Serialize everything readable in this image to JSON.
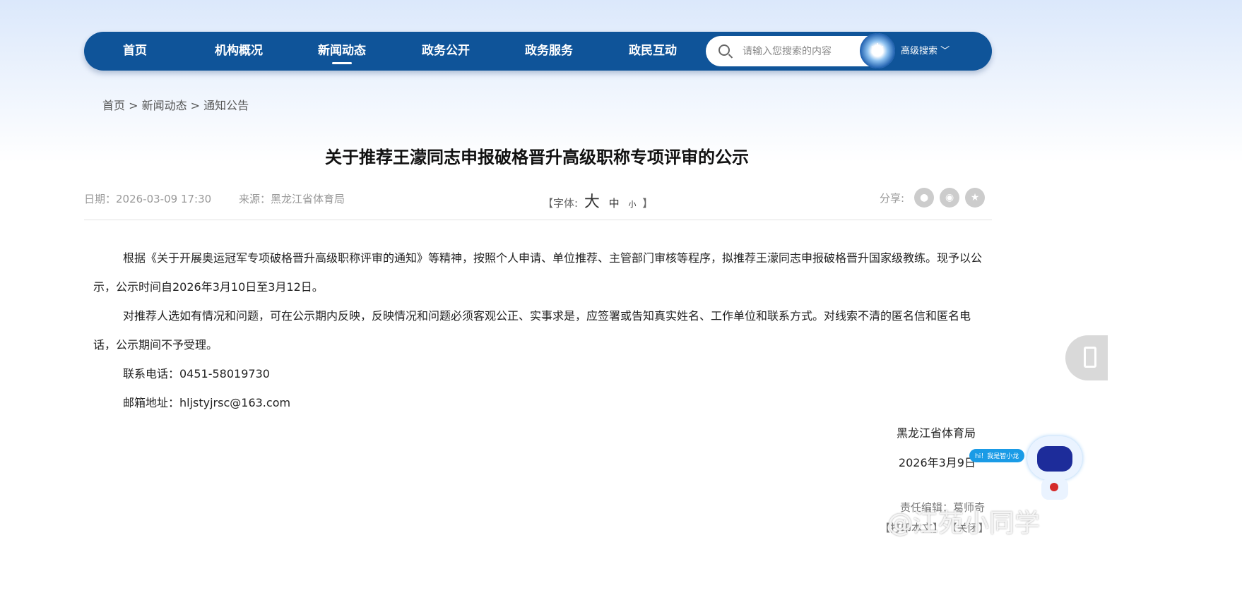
{
  "nav": {
    "items": [
      "首页",
      "机构概况",
      "新闻动态",
      "政务公开",
      "政务服务",
      "政民互动"
    ],
    "active": 2,
    "search_placeholder": "请输入您搜索的内容",
    "advanced": "高级搜索"
  },
  "breadcrumb": "首页 > 新闻动态 > 通知公告",
  "article": {
    "title": "关于推荐王濛同志申报破格晋升高级职称专项评审的公示",
    "date": "日期：2026-03-09 17:30",
    "source": "来源：黑龙江省体育局",
    "font_label_open": "【字体:",
    "font_large": "大",
    "font_medium": "中",
    "font_small": "小",
    "font_label_close": "】",
    "share_label": "分享:",
    "paragraphs": [
      "根据《关于开展奥运冠军专项破格晋升高级职称评审的通知》等精神，按照个人申请、单位推荐、主管部门审核等程序，拟推荐王濛同志申报破格晋升国家级教练。现予以公示，公示时间自2026年3月10日至3月12日。",
      "对推荐人选如有情况和问题，可在公示期内反映，反映情况和问题必须客观公正、实事求是，应签署或告知真实姓名、工作单位和联系方式。对线索不清的匿名信和匿名电话，公示期间不予受理。",
      "联系电话：0451-58019730",
      "邮箱地址：hljstyjrsc@163.com"
    ],
    "signature_org": "黑龙江省体育局",
    "signature_date": "2026年3月9日",
    "editor": "责任编辑：葛师奇",
    "print": "【打印本文】",
    "close": "【关闭】"
  },
  "assistant": {
    "bubble": "hi！我是智小龙"
  },
  "watermark": "@江苑小同学"
}
